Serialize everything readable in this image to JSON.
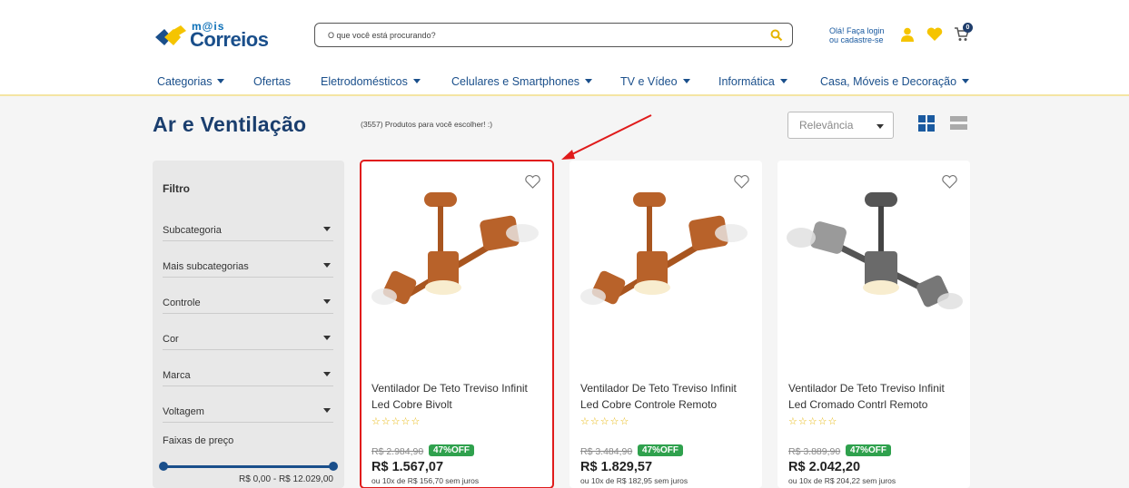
{
  "header": {
    "logo_mais": "m@is",
    "logo_text": "Correios",
    "search_placeholder": "O que você está procurando?",
    "login_line1": "Olá! Faça login",
    "login_line2": "ou cadastre-se",
    "cart_count": "0",
    "icons": [
      "search-icon",
      "user-icon",
      "heart-icon",
      "cart-icon"
    ]
  },
  "nav": {
    "items": [
      {
        "label": "Categorias",
        "dropdown": true
      },
      {
        "label": "Ofertas",
        "dropdown": false
      },
      {
        "label": "Eletrodomésticos",
        "dropdown": true
      },
      {
        "label": "Celulares e Smartphones",
        "dropdown": true
      },
      {
        "label": "TV e Vídeo",
        "dropdown": true
      },
      {
        "label": "Informática",
        "dropdown": true
      },
      {
        "label": "Casa, Móveis e Decoração",
        "dropdown": true
      }
    ]
  },
  "page": {
    "title": "Ar e Ventilação",
    "count_text": "(3557) Produtos para você escolher! :)",
    "sort_value": "Relevância"
  },
  "filter": {
    "title": "Filtro",
    "rows": [
      "Subcategoria",
      "Mais subcategorias",
      "Controle",
      "Cor",
      "Marca",
      "Voltagem"
    ],
    "price_label": "Faixas de preço",
    "price_range": "R$ 0,00 - R$ 12.029,00"
  },
  "products": [
    {
      "name": "Ventilador De Teto Treviso Infinit Led Cobre Bivolt",
      "old_price": "R$ 2.984,90",
      "discount": "47%OFF",
      "price": "R$ 1.567,07",
      "installments": "ou 10x de R$ 156,70 sem juros",
      "stars": "☆☆☆☆☆",
      "finish": "copper"
    },
    {
      "name": "Ventilador De Teto Treviso Infinit Led Cobre Controle Remoto",
      "old_price": "R$ 3.484,90",
      "discount": "47%OFF",
      "price": "R$ 1.829,57",
      "installments": "ou 10x de R$ 182,95 sem juros",
      "stars": "☆☆☆☆☆",
      "finish": "copper"
    },
    {
      "name": "Ventilador De Teto Treviso Infinit Led Cromado Contrl Remoto",
      "old_price": "R$ 3.889,90",
      "discount": "47%OFF",
      "price": "R$ 2.042,20",
      "installments": "ou 10x de R$ 204,22 sem juros",
      "stars": "☆☆☆☆☆",
      "finish": "chrome"
    }
  ],
  "colors": {
    "brand_blue": "#1a4f8b",
    "accent_yellow": "#f5c400",
    "discount_green": "#2fa14d",
    "highlight_red": "#e01b1b"
  }
}
